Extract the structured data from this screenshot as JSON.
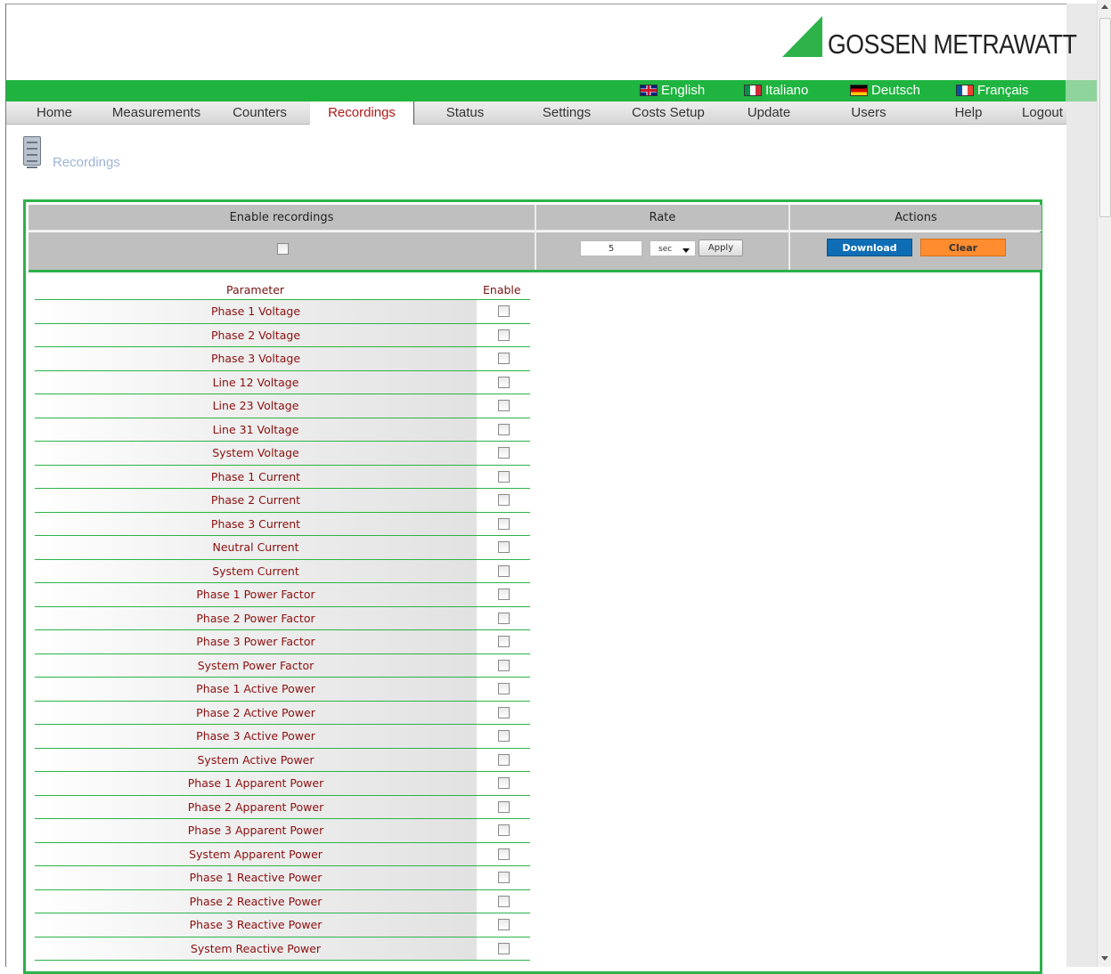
{
  "brand": {
    "name": "GOSSEN METRAWATT",
    "accent": "#2db34a"
  },
  "languages": [
    {
      "label": "English",
      "flag": "flag-uk"
    },
    {
      "label": "Italiano",
      "flag": "flag-it"
    },
    {
      "label": "Deutsch",
      "flag": "flag-de"
    },
    {
      "label": "Français",
      "flag": "flag-fr"
    }
  ],
  "nav": {
    "items": [
      "Home",
      "Measurements",
      "Counters",
      "Recordings",
      "Status",
      "Settings",
      "Costs Setup",
      "Update",
      "Users",
      "Help",
      "Logout"
    ],
    "active": "Recordings"
  },
  "page": {
    "title": "Recordings",
    "icon": "document-icon"
  },
  "controls": {
    "enable_header": "Enable recordings",
    "rate_header": "Rate",
    "actions_header": "Actions",
    "rate_value": "5",
    "rate_unit": "sec",
    "apply_label": "Apply",
    "download_label": "Download",
    "clear_label": "Clear",
    "download_color": "#0f6db5",
    "clear_color": "#ff8c2e"
  },
  "parameters": {
    "header_parameter": "Parameter",
    "header_enable": "Enable",
    "rows": [
      "Phase 1 Voltage",
      "Phase 2 Voltage",
      "Phase 3 Voltage",
      "Line 12 Voltage",
      "Line 23 Voltage",
      "Line 31 Voltage",
      "System Voltage",
      "Phase 1 Current",
      "Phase 2 Current",
      "Phase 3 Current",
      "Neutral Current",
      "System Current",
      "Phase 1 Power Factor",
      "Phase 2 Power Factor",
      "Phase 3 Power Factor",
      "System Power Factor",
      "Phase 1 Active Power",
      "Phase 2 Active Power",
      "Phase 3 Active Power",
      "System Active Power",
      "Phase 1 Apparent Power",
      "Phase 2 Apparent Power",
      "Phase 3 Apparent Power",
      "System Apparent Power",
      "Phase 1 Reactive Power",
      "Phase 2 Reactive Power",
      "Phase 3 Reactive Power",
      "System Reactive Power"
    ]
  }
}
